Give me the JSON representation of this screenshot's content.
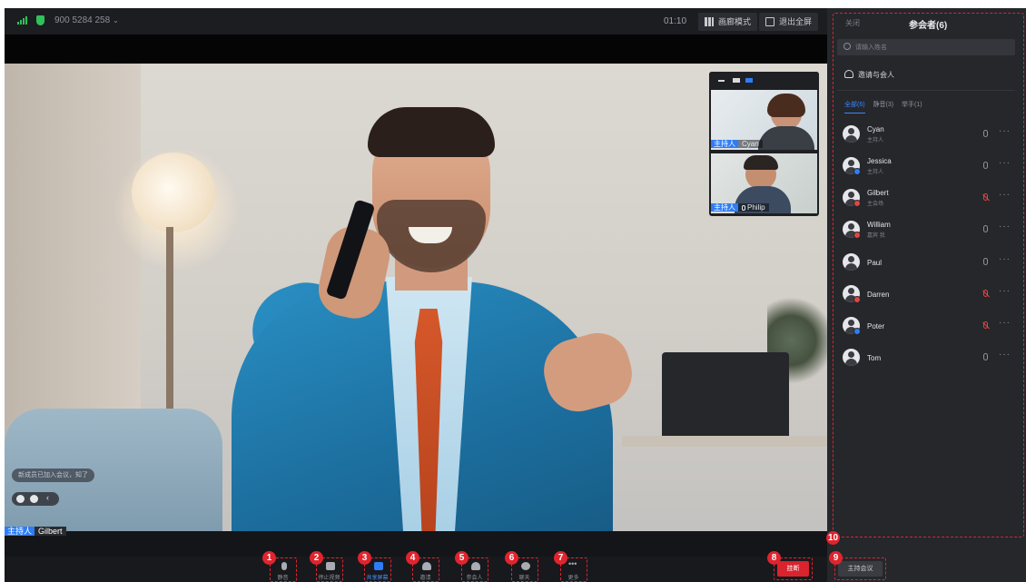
{
  "topbar": {
    "meeting_id": "900 5284 258",
    "timer": "01:10",
    "gallery_button": "画廊模式",
    "exit_fullscreen_button": "退出全屏"
  },
  "pip": {
    "tiles": [
      {
        "role": "主持人",
        "name": "Cyan"
      },
      {
        "role": "主持人",
        "name": "Philip"
      }
    ]
  },
  "video": {
    "chat_notice": "新成员已加入会议，知了",
    "speaker_role": "主持人",
    "speaker_name": "Gilbert"
  },
  "toolbar": {
    "buttons": [
      {
        "badge": "1",
        "label": "静音",
        "icon": "microphone-icon"
      },
      {
        "badge": "2",
        "label": "停止视频",
        "icon": "camera-icon"
      },
      {
        "badge": "3",
        "label": "共享屏幕",
        "icon": "share-screen-icon"
      },
      {
        "badge": "4",
        "label": "邀请",
        "icon": "invite-icon"
      },
      {
        "badge": "5",
        "label": "参会人",
        "icon": "participants-icon"
      },
      {
        "badge": "6",
        "label": "聊天",
        "icon": "chat-icon"
      },
      {
        "badge": "7",
        "label": "更多",
        "icon": "more-icon"
      }
    ],
    "hangup": {
      "badge": "8",
      "label": "挂断"
    },
    "host_meeting": {
      "badge": "9",
      "label": "主持会议"
    }
  },
  "panel": {
    "badge": "10",
    "close_label": "关闭",
    "title": "参会者(6)",
    "search_placeholder": "请输入姓名",
    "invite_label": "邀请与会人",
    "tabs": [
      "全部(6)",
      "静音(3)",
      "举手(1)"
    ],
    "participants": [
      {
        "name": "Cyan",
        "role": "主持人",
        "muted": false,
        "dot": ""
      },
      {
        "name": "Jessica",
        "role": "主持人",
        "muted": false,
        "dot": "#2f7df6"
      },
      {
        "name": "Gilbert",
        "role": "主会场",
        "muted": true,
        "dot": "#e0473f"
      },
      {
        "name": "William",
        "role": "嘉宾 我",
        "muted": false,
        "dot": "#e0473f"
      },
      {
        "name": "Paul",
        "role": "",
        "muted": false,
        "dot": ""
      },
      {
        "name": "Darren",
        "role": "",
        "muted": true,
        "dot": "#e0473f"
      },
      {
        "name": "Poter",
        "role": "",
        "muted": true,
        "dot": "#2f7df6"
      },
      {
        "name": "Tom",
        "role": "",
        "muted": false,
        "dot": ""
      }
    ]
  },
  "colors": {
    "accent": "#2f7df6",
    "danger": "#e0242e",
    "signal": "#31c15a"
  }
}
